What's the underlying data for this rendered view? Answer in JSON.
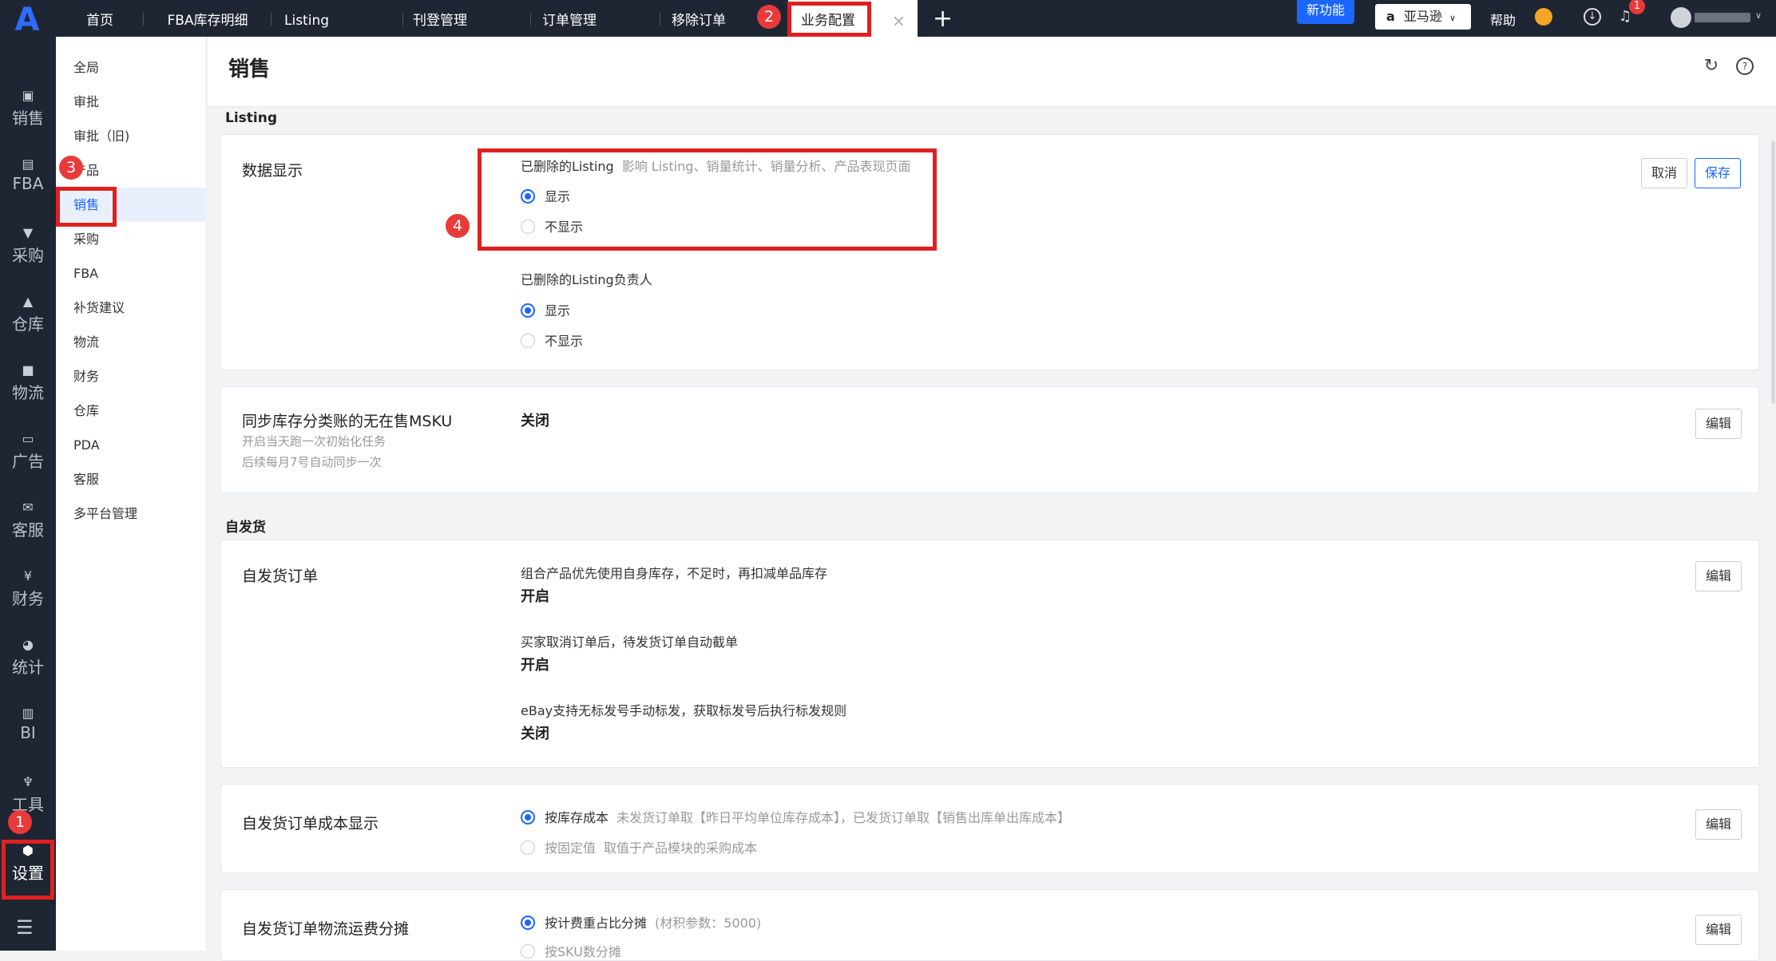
{
  "app": {
    "logo": "A"
  },
  "tabs": [
    {
      "label": "首页"
    },
    {
      "label": "FBA库存明细"
    },
    {
      "label": "Listing"
    },
    {
      "label": "刊登管理"
    },
    {
      "label": "订单管理"
    },
    {
      "label": "移除订单"
    },
    {
      "label": "业务配置",
      "active": true
    }
  ],
  "tab_add": "+",
  "tab_close": "×",
  "topbar": {
    "new_feature": "新功能",
    "store": "亚马逊",
    "help": "帮助",
    "notification_count": "1"
  },
  "left_nav": [
    {
      "label": "销售",
      "icon": "sell-icon"
    },
    {
      "label": "FBA",
      "icon": "fba-icon"
    },
    {
      "label": "采购",
      "icon": "cart-icon"
    },
    {
      "label": "仓库",
      "icon": "warehouse-icon"
    },
    {
      "label": "物流",
      "icon": "truck-icon"
    },
    {
      "label": "广告",
      "icon": "ad-icon"
    },
    {
      "label": "客服",
      "icon": "mail-icon"
    },
    {
      "label": "财务",
      "icon": "yen-icon"
    },
    {
      "label": "统计",
      "icon": "pie-icon"
    },
    {
      "label": "BI",
      "icon": "bi-icon"
    },
    {
      "label": "工具",
      "icon": "wrench-icon"
    },
    {
      "label": "设置",
      "icon": "gear-icon"
    }
  ],
  "sub_nav": [
    {
      "label": "全局"
    },
    {
      "label": "审批"
    },
    {
      "label": "审批（旧)"
    },
    {
      "label": "产品"
    },
    {
      "label": "销售",
      "active": true
    },
    {
      "label": "采购"
    },
    {
      "label": "FBA"
    },
    {
      "label": "补货建议"
    },
    {
      "label": "物流"
    },
    {
      "label": "财务"
    },
    {
      "label": "仓库"
    },
    {
      "label": "PDA"
    },
    {
      "label": "客服"
    },
    {
      "label": "多平台管理"
    }
  ],
  "page": {
    "title": "销售"
  },
  "section_listing": "Listing",
  "section_self": "自发货",
  "card1": {
    "title": "数据显示",
    "opt1_label": "已删除的Listing",
    "opt1_hint": "影响 Listing、销量统计、销量分析、产品表现页面",
    "opt2_label": "已删除的Listing负责人",
    "show": "显示",
    "hide": "不显示",
    "cancel": "取消",
    "save": "保存"
  },
  "card2": {
    "title": "同步库存分类账的无在售MSKU",
    "sub1": "开启当天跑一次初始化任务",
    "sub2": "后续每月7号自动同步一次",
    "value": "关闭",
    "edit": "编辑"
  },
  "card3": {
    "title": "自发货订单",
    "l1": "组合产品优先使用自身库存，不足时，再扣减单品库存",
    "v1": "开启",
    "l2": "买家取消订单后，待发货订单自动截单",
    "v2": "开启",
    "l3": "eBay支持无标发号手动标发，获取标发号后执行标发规则",
    "v3": "关闭",
    "edit": "编辑"
  },
  "card4": {
    "title": "自发货订单成本显示",
    "opt1": "按库存成本",
    "opt1_hint": "未发货订单取【昨日平均单位库存成本】，已发货订单取【销售出库单出库成本】",
    "opt2": "按固定值",
    "opt2_hint": "取值于产品模块的采购成本",
    "edit": "编辑"
  },
  "card5": {
    "title": "自发货订单物流运费分摊",
    "opt1": "按计费重占比分摊",
    "opt1_hint": "(材积参数：5000)",
    "opt2": "按SKU数分摊",
    "edit": "编辑"
  },
  "steps": [
    "1",
    "2",
    "3",
    "4"
  ]
}
